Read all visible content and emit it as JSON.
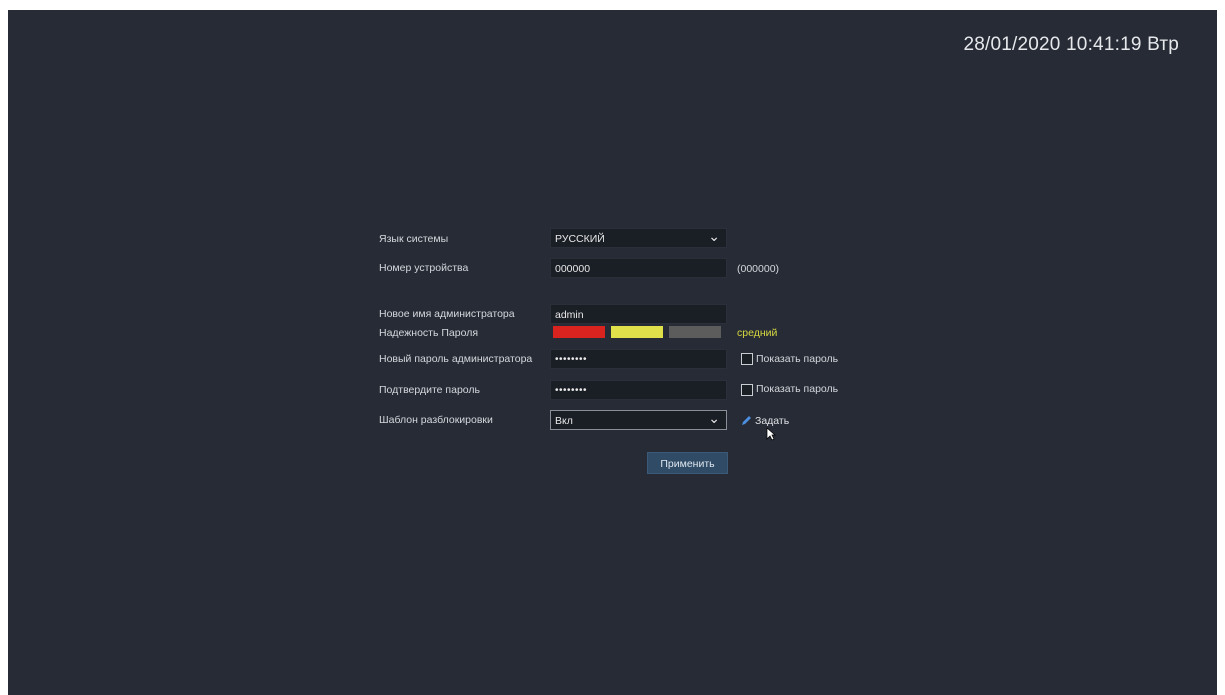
{
  "datetime": "28/01/2020 10:41:19 Втр",
  "form": {
    "language": {
      "label": "Язык системы",
      "value": "РУССКИЙ"
    },
    "device_number": {
      "label": "Номер устройства",
      "value": "000000",
      "hint": "(000000)"
    },
    "admin_name": {
      "label": "Новое имя администратора",
      "value": "admin"
    },
    "password_strength": {
      "label": "Надежность Пароля",
      "level_text": "средний",
      "level": 2,
      "max_level": 3,
      "colors": [
        "#d9231f",
        "#dfe04a",
        "#5c5c5c"
      ]
    },
    "new_password": {
      "label": "Новый пароль администратора",
      "value": "••••••••",
      "show_label": "Показать пароль"
    },
    "confirm_password": {
      "label": "Подтвердите пароль",
      "value": "••••••••",
      "show_label": "Показать пароль"
    },
    "unlock_pattern": {
      "label": "Шаблон разблокировки",
      "value": "Вкл",
      "set_label": "Задать"
    },
    "apply_label": "Применить"
  },
  "colors": {
    "background": "#262b35",
    "accent_button": "#2f4b66",
    "strength_text": "#d8d940"
  }
}
